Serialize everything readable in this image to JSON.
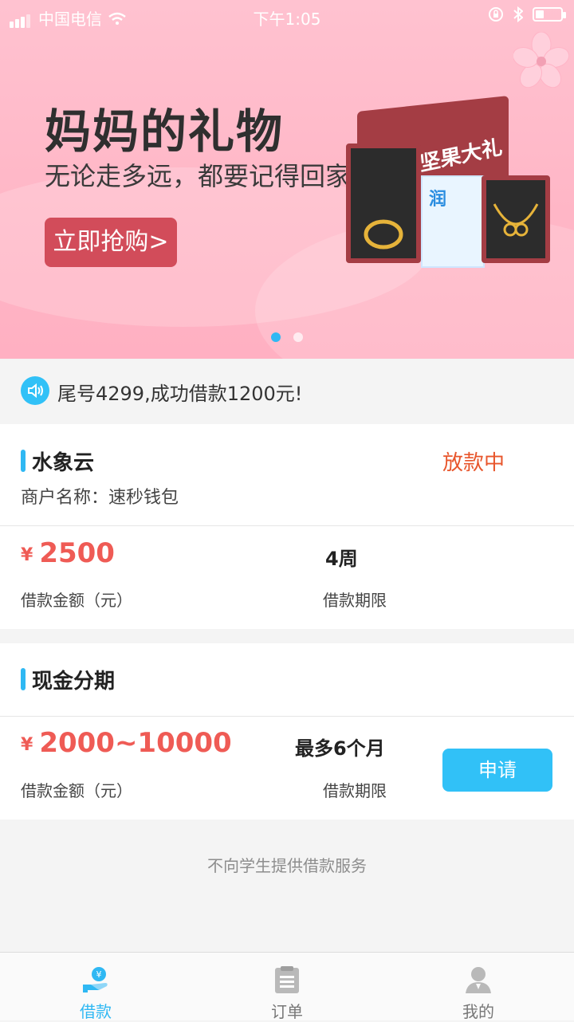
{
  "status_bar": {
    "carrier": "中国电信",
    "time": "下午1:05"
  },
  "banner": {
    "title": "妈妈的礼物",
    "subtitle": "无论走多远，都要记得回家",
    "button": "立即抢购>",
    "product_box_label": "坚果大礼包",
    "mask_pack_label": "润",
    "active_dot": 0,
    "dots": 2
  },
  "notice": {
    "text": "尾号4299,成功借款1200元!"
  },
  "loan_card": {
    "title": "水象云",
    "status": "放款中",
    "merchant": "商户名称：速秒钱包",
    "amount": "2500",
    "currency": "¥",
    "amount_label": "借款金额（元）",
    "term": "4周",
    "term_label": "借款期限"
  },
  "installment_card": {
    "title": "现金分期",
    "amount": "2000~10000",
    "currency": "¥",
    "amount_label": "借款金额（元）",
    "term": "最多6个月",
    "term_label": "借款期限",
    "apply": "申请"
  },
  "footer_note": "不向学生提供借款服务",
  "tabs": [
    {
      "label": "借款",
      "icon": "loan-icon",
      "active": true
    },
    {
      "label": "订单",
      "icon": "order-icon",
      "active": false
    },
    {
      "label": "我的",
      "icon": "profile-icon",
      "active": false
    }
  ],
  "colors": {
    "accent": "#2fb8f3",
    "amount": "#ef5b55",
    "status": "#e8562c",
    "banner_button": "#d24c5a"
  }
}
